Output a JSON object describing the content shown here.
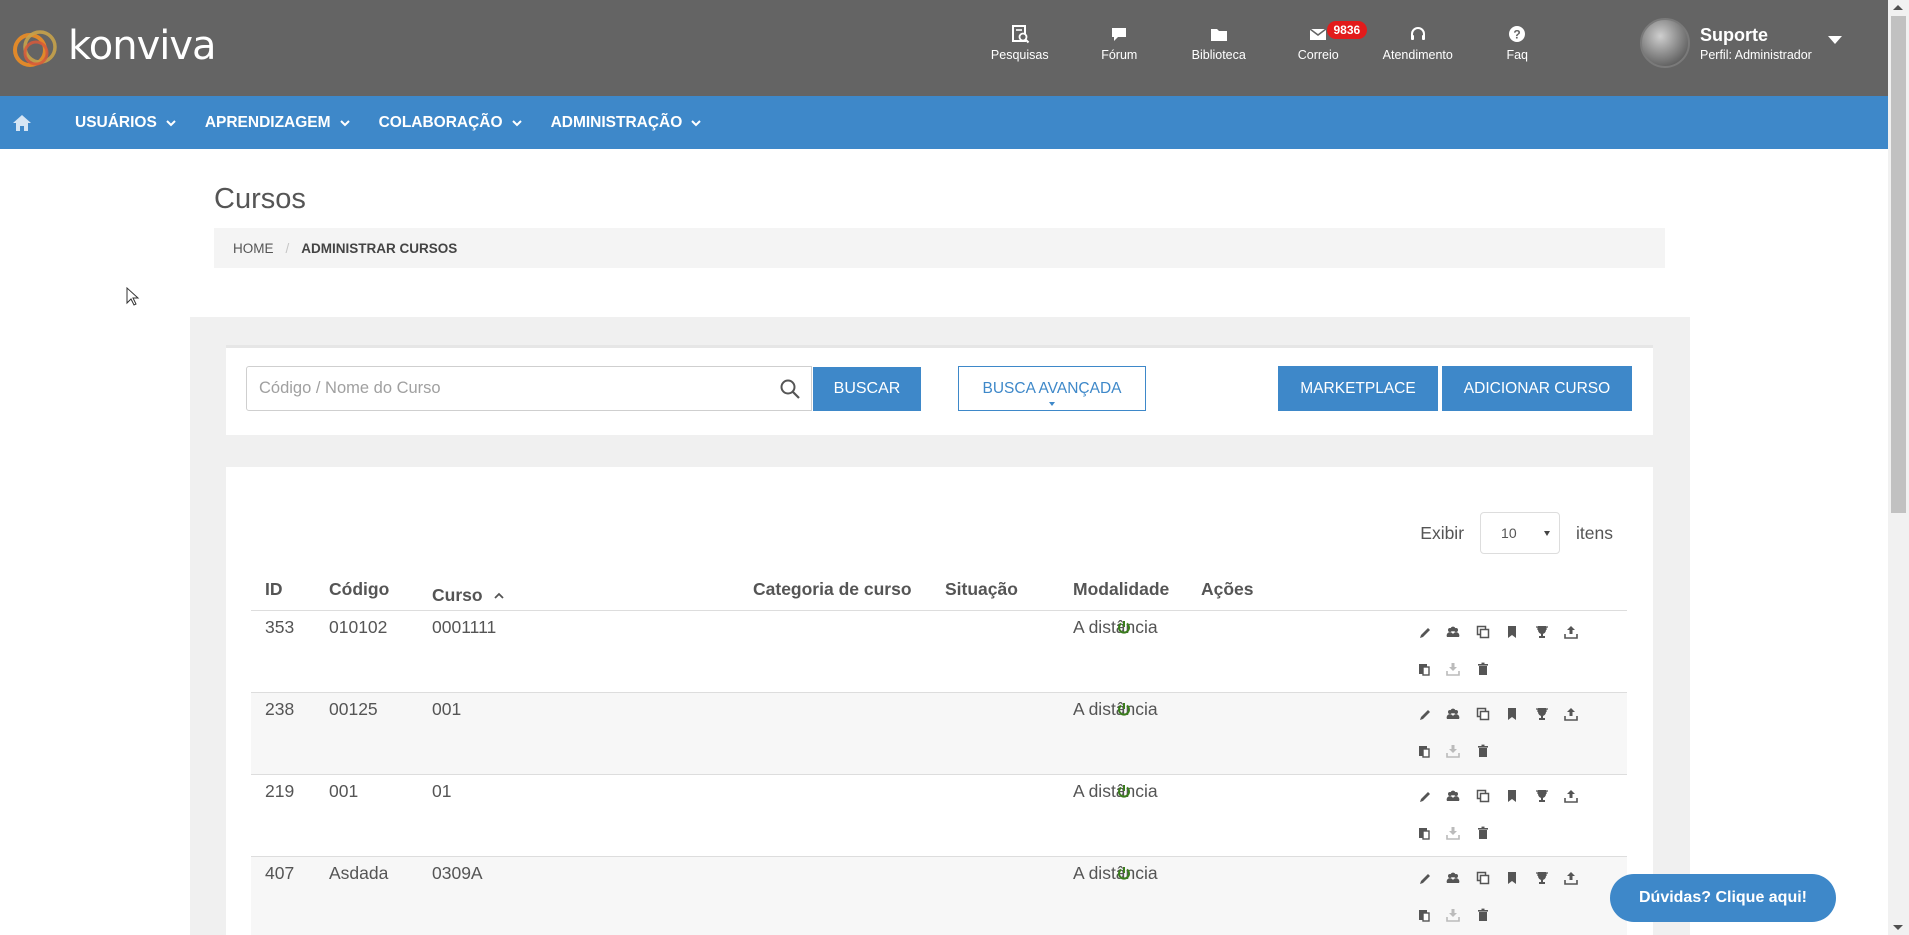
{
  "brand": {
    "name": "konviva"
  },
  "topnav": [
    {
      "label": "Pesquisas",
      "icon": "survey-icon"
    },
    {
      "label": "Fórum",
      "icon": "forum-icon"
    },
    {
      "label": "Biblioteca",
      "icon": "folder-icon"
    },
    {
      "label": "Correio",
      "icon": "mail-icon",
      "badge": "9836"
    },
    {
      "label": "Atendimento",
      "icon": "headset-icon"
    },
    {
      "label": "Faq",
      "icon": "help-icon"
    }
  ],
  "user": {
    "name": "Suporte",
    "role": "Perfil: Administrador"
  },
  "menu": [
    {
      "label": "USUÁRIOS"
    },
    {
      "label": "APRENDIZAGEM"
    },
    {
      "label": "COLABORAÇÃO"
    },
    {
      "label": "ADMINISTRAÇÃO"
    }
  ],
  "page": {
    "title": "Cursos",
    "breadcrumb": {
      "home": "HOME",
      "separator": "/",
      "current": "ADMINISTRAR CURSOS"
    }
  },
  "search": {
    "placeholder": "Código / Nome do Curso",
    "button": "BUSCAR",
    "advanced": "BUSCA AVANÇADA",
    "marketplace": "MARKETPLACE",
    "add_course": "ADICIONAR CURSO"
  },
  "pagination": {
    "show_label": "Exibir",
    "page_size": "10",
    "items_label": "itens"
  },
  "table": {
    "columns": [
      "ID",
      "Código",
      "Curso",
      "Categoria de curso",
      "Situação",
      "Modalidade",
      "Ações"
    ],
    "sorted_column": "Curso",
    "sort_direction": "ascending",
    "rows": [
      {
        "id": "353",
        "codigo": "010102",
        "curso": "0001111",
        "categoria": "",
        "situacao": "active",
        "modalidade": "A distância"
      },
      {
        "id": "238",
        "codigo": "00125",
        "curso": "001",
        "categoria": "",
        "situacao": "active",
        "modalidade": "A distância"
      },
      {
        "id": "219",
        "codigo": "001",
        "curso": "01",
        "categoria": "",
        "situacao": "active",
        "modalidade": "A distância"
      },
      {
        "id": "407",
        "codigo": "Asdada",
        "curso": "0309A",
        "categoria": "",
        "situacao": "active",
        "modalidade": "A distância"
      }
    ],
    "row_actions": [
      "edit-icon",
      "users-icon",
      "copy-icon",
      "bookmark-icon",
      "trophy-icon",
      "upload-icon",
      "paste-icon",
      "download-icon",
      "trash-icon"
    ]
  },
  "help": {
    "label": "Dúvidas? Clique aqui!"
  },
  "colors": {
    "header_bg": "#646464",
    "menu_bg": "#3e88c9",
    "accent": "#3e88c9",
    "badge": "#e21b1b",
    "status_active": "#3a7d1c"
  }
}
